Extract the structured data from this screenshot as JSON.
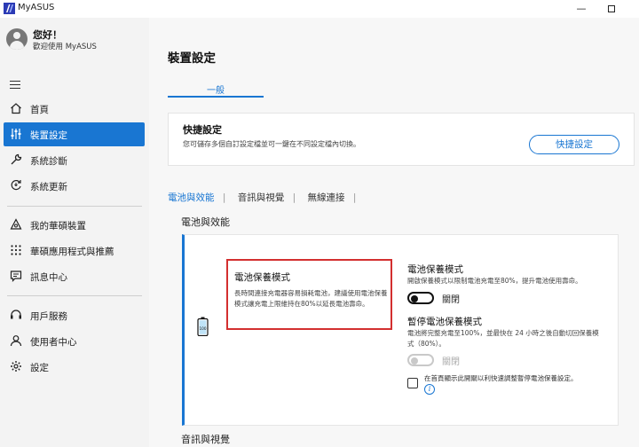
{
  "window": {
    "title": "MyASUS"
  },
  "user": {
    "greeting": "您好！",
    "welcome": "歡迎使用 MyASUS"
  },
  "sidebar": {
    "items": [
      {
        "label": "首頁",
        "icon": "home-icon",
        "active": false
      },
      {
        "label": "裝置設定",
        "icon": "sliders-icon",
        "active": true
      },
      {
        "label": "系統診斷",
        "icon": "wrench-icon",
        "active": false
      },
      {
        "label": "系統更新",
        "icon": "update-icon",
        "active": false
      },
      {
        "label": "我的華碩裝置",
        "icon": "devices-icon",
        "active": false
      },
      {
        "label": "華碩應用程式與推薦",
        "icon": "apps-grid-icon",
        "active": false
      },
      {
        "label": "訊息中心",
        "icon": "message-icon",
        "active": false
      },
      {
        "label": "用戶服務",
        "icon": "headset-icon",
        "active": false
      },
      {
        "label": "使用者中心",
        "icon": "user-icon",
        "active": false
      },
      {
        "label": "設定",
        "icon": "gear-icon",
        "active": false
      }
    ]
  },
  "main": {
    "title": "裝置設定",
    "tab": "一般",
    "quick": {
      "title": "快捷設定",
      "desc": "您可儲存多個自訂設定檔並可一鍵在不同設定檔內切換。",
      "button": "快捷設定"
    },
    "subnav": [
      "電池與效能",
      "音訊與視覺",
      "無線連接"
    ],
    "section1": "電池與效能",
    "section2": "音訊與視覺",
    "highlight": {
      "title": "電池保養模式",
      "desc": "長時間連接充電器容易損耗電池，建議使用電池保養模式讓充電上限維持在80%以延長電池壽命。"
    },
    "battery_icon_value": "100",
    "care_mode": {
      "title": "電池保養模式",
      "desc": "開啟保養模式以限制電池充電至80%，提升電池使用壽命。",
      "toggle_label": "關閉"
    },
    "pause_mode": {
      "title": "暫停電池保養模式",
      "desc": "電池將完整充電至100%，並最快在 24 小時之後自動切回保養模式（80%）。",
      "toggle_label": "關閉",
      "checkbox_label": "在首頁顯示此開關以利快速調整暫停電池保養設定。"
    }
  },
  "colors": {
    "accent": "#1976d2",
    "highlight": "#d32f2f"
  }
}
